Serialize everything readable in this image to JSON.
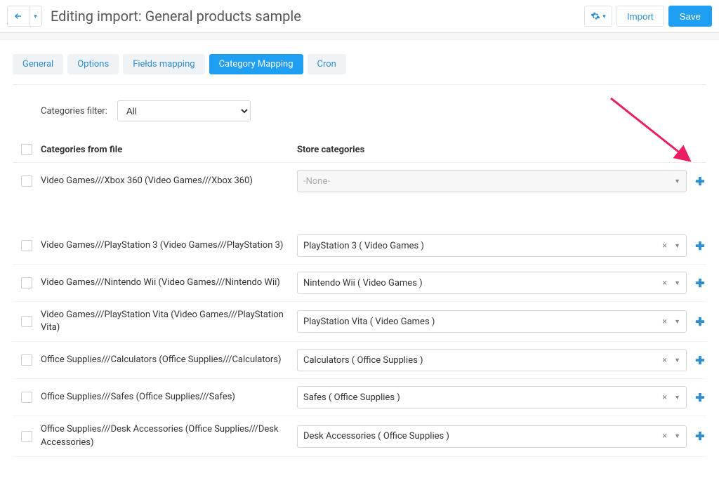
{
  "header": {
    "title": "Editing import: General products sample",
    "import_label": "Import",
    "save_label": "Save"
  },
  "tabs": [
    {
      "label": "General"
    },
    {
      "label": "Options"
    },
    {
      "label": "Fields mapping"
    },
    {
      "label": "Category Mapping",
      "active": true
    },
    {
      "label": "Cron"
    }
  ],
  "filter": {
    "label": "Categories filter:",
    "selected": "All"
  },
  "columns": {
    "file": "Categories from file",
    "store": "Store categories"
  },
  "rows": [
    {
      "file": "Video Games///Xbox 360 (Video Games///Xbox 360)",
      "store": "-None-",
      "empty": true
    },
    {
      "file": "Video Games///PlayStation 3 (Video Games///PlayStation 3)",
      "store": "PlayStation 3 ( Video Games )"
    },
    {
      "file": "Video Games///Nintendo Wii (Video Games///Nintendo Wii)",
      "store": "Nintendo Wii ( Video Games )"
    },
    {
      "file": "Video Games///PlayStation Vita (Video Games///PlayStation Vita)",
      "store": "PlayStation Vita ( Video Games )"
    },
    {
      "file": "Office Supplies///Calculators (Office Supplies///Calculators)",
      "store": "Calculators ( Office Supplies )"
    },
    {
      "file": "Office Supplies///Safes (Office Supplies///Safes)",
      "store": "Safes ( Office Supplies )"
    },
    {
      "file": "Office Supplies///Desk Accessories (Office Supplies///Desk Accessories)",
      "store": "Desk Accessories ( Office Supplies )"
    }
  ]
}
